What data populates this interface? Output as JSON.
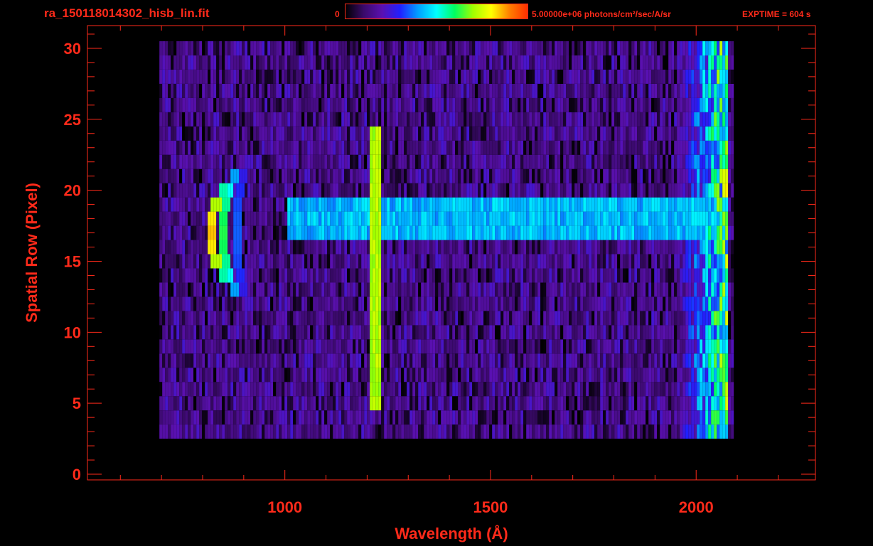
{
  "header": {
    "file_title": "ra_150118014302_hisb_lin.fit",
    "colorbar_min": "0",
    "colorbar_max": "5.00000e+06 photons/cm²/sec/A/sr",
    "exptime": "EXPTIME = 604 s"
  },
  "colors": {
    "background": "#000000",
    "axes": "#ff2a1a",
    "colormap": [
      "#000000",
      "#3a0a6a",
      "#5a10b0",
      "#2020ff",
      "#00a0ff",
      "#00ffff",
      "#00ff60",
      "#a0ff00",
      "#ffff00",
      "#ff8000",
      "#ff3000"
    ]
  },
  "chart_data": {
    "type": "heatmap",
    "title": "",
    "xlabel": "Wavelength (Å)",
    "ylabel": "Spatial Row (Pixel)",
    "xlim": [
      520,
      2290
    ],
    "ylim": [
      -0.4,
      31.6
    ],
    "x_ticks": [
      1000,
      1500,
      2000
    ],
    "x_tick_labels": [
      "1000",
      "1500",
      "2000"
    ],
    "y_ticks": [
      0,
      5,
      10,
      15,
      20,
      25,
      30
    ],
    "y_tick_labels": [
      "0",
      "5",
      "10",
      "15",
      "20",
      "25",
      "30"
    ],
    "colorbar_range": [
      0,
      5000000
    ],
    "colorbar_units": "photons/cm²/sec/A/sr",
    "data_extent": {
      "wavelength": [
        695,
        2085
      ],
      "rows": [
        3,
        30
      ]
    },
    "features": [
      {
        "feature": "emission line",
        "wavelength": 1216,
        "rows": [
          5,
          24
        ],
        "intensity": 0.72
      },
      {
        "feature": "curved line",
        "wavelength_center": 818,
        "rows": [
          14,
          20
        ],
        "intensity": 0.85
      },
      {
        "feature": "curved line",
        "wavelength_center": 847,
        "rows": [
          13,
          21
        ],
        "intensity": 0.62
      },
      {
        "feature": "curved line",
        "wavelength_center": 880,
        "rows": [
          12,
          22
        ],
        "intensity": 0.35
      },
      {
        "feature": "continuum band",
        "wavelength": [
          1000,
          2075
        ],
        "rows": [
          17,
          19
        ],
        "intensity": 0.45
      },
      {
        "feature": "red edge",
        "wavelength": [
          1950,
          2075
        ],
        "rows": [
          3,
          30
        ],
        "intensity": 0.55
      }
    ]
  }
}
